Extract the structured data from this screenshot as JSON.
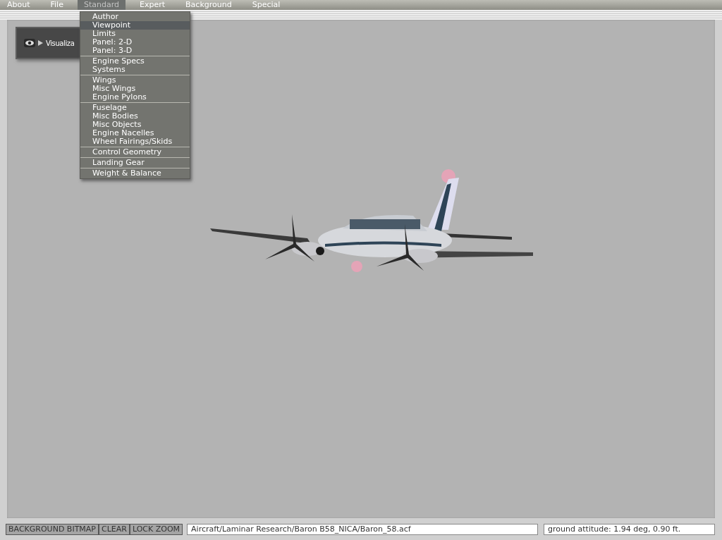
{
  "menu_bar": [
    {
      "label": "About",
      "selected": false
    },
    {
      "label": "File",
      "selected": false
    },
    {
      "label": "Standard",
      "selected": true
    },
    {
      "label": "Expert",
      "selected": false
    },
    {
      "label": "Background",
      "selected": false
    },
    {
      "label": "Special",
      "selected": false
    }
  ],
  "dropdown": {
    "groups": [
      {
        "items": [
          {
            "label": "Author",
            "selected": false
          },
          {
            "label": "Viewpoint",
            "selected": true
          },
          {
            "label": "Limits",
            "selected": false
          },
          {
            "label": "Panel: 2-D",
            "selected": false
          },
          {
            "label": "Panel: 3-D",
            "selected": false
          }
        ]
      },
      {
        "items": [
          {
            "label": "Engine Specs",
            "selected": false
          },
          {
            "label": "Systems",
            "selected": false
          }
        ]
      },
      {
        "items": [
          {
            "label": "Wings",
            "selected": false
          },
          {
            "label": "Misc Wings",
            "selected": false
          },
          {
            "label": "Engine Pylons",
            "selected": false
          }
        ]
      },
      {
        "items": [
          {
            "label": "Fuselage",
            "selected": false
          },
          {
            "label": "Misc Bodies",
            "selected": false
          },
          {
            "label": "Misc Objects",
            "selected": false
          },
          {
            "label": "Engine Nacelles",
            "selected": false
          },
          {
            "label": "Wheel Fairings/Skids",
            "selected": false
          }
        ]
      },
      {
        "items": [
          {
            "label": "Control Geometry",
            "selected": false
          }
        ]
      },
      {
        "items": [
          {
            "label": "Landing Gear",
            "selected": false
          }
        ]
      },
      {
        "items": [
          {
            "label": "Weight & Balance",
            "selected": false
          }
        ]
      }
    ]
  },
  "visualization_panel": {
    "label": "Visualiza",
    "expanded": false
  },
  "status_bar": {
    "buttons": [
      "BACKGROUND BITMAP",
      "CLEAR",
      "LOCK ZOOM"
    ],
    "file_path": "Aircraft/Laminar Research/Baron B58_NICA/Baron_58.acf",
    "readout": "ground attitude: 1.94 deg, 0.90 ft."
  }
}
